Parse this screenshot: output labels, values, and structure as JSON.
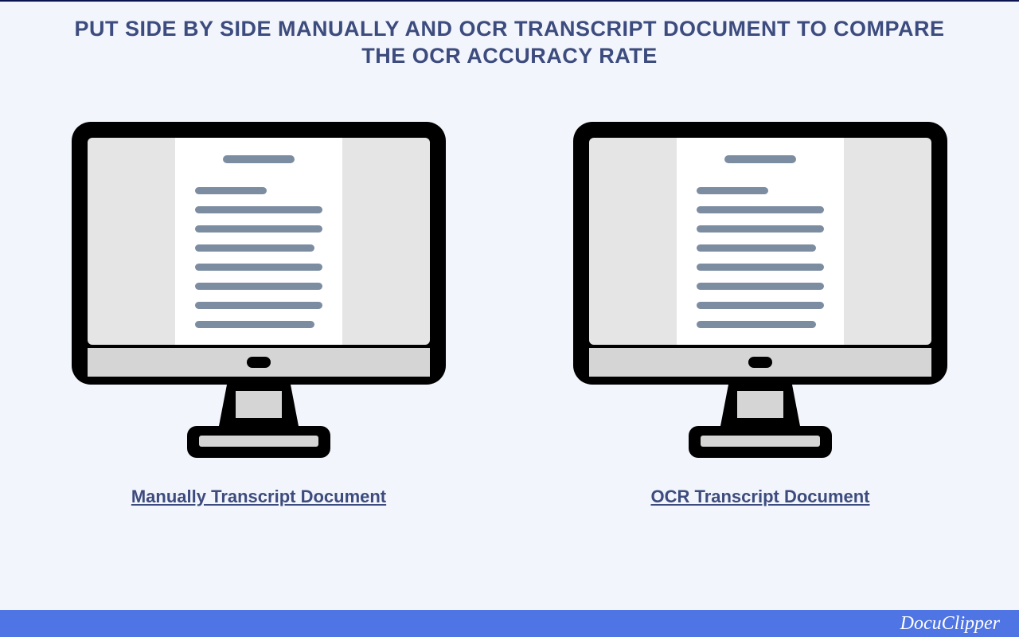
{
  "title": "PUT SIDE BY SIDE MANUALLY AND OCR TRANSCRIPT DOCUMENT TO COMPARE THE OCR ACCURACY RATE",
  "left_label": "Manually Transcript Document",
  "right_label": "OCR Transcript Document",
  "brand": "DocuClipper",
  "colors": {
    "bg": "#f3f5fc",
    "heading": "#3d4c7e",
    "footer": "#4f74e3",
    "monitor_outline": "#000000",
    "screen_bg": "#e5e5e5",
    "page_bg": "#ffffff",
    "text_line": "#7d8da1"
  },
  "icons": {
    "left": "monitor-document-icon",
    "right": "monitor-document-icon"
  }
}
